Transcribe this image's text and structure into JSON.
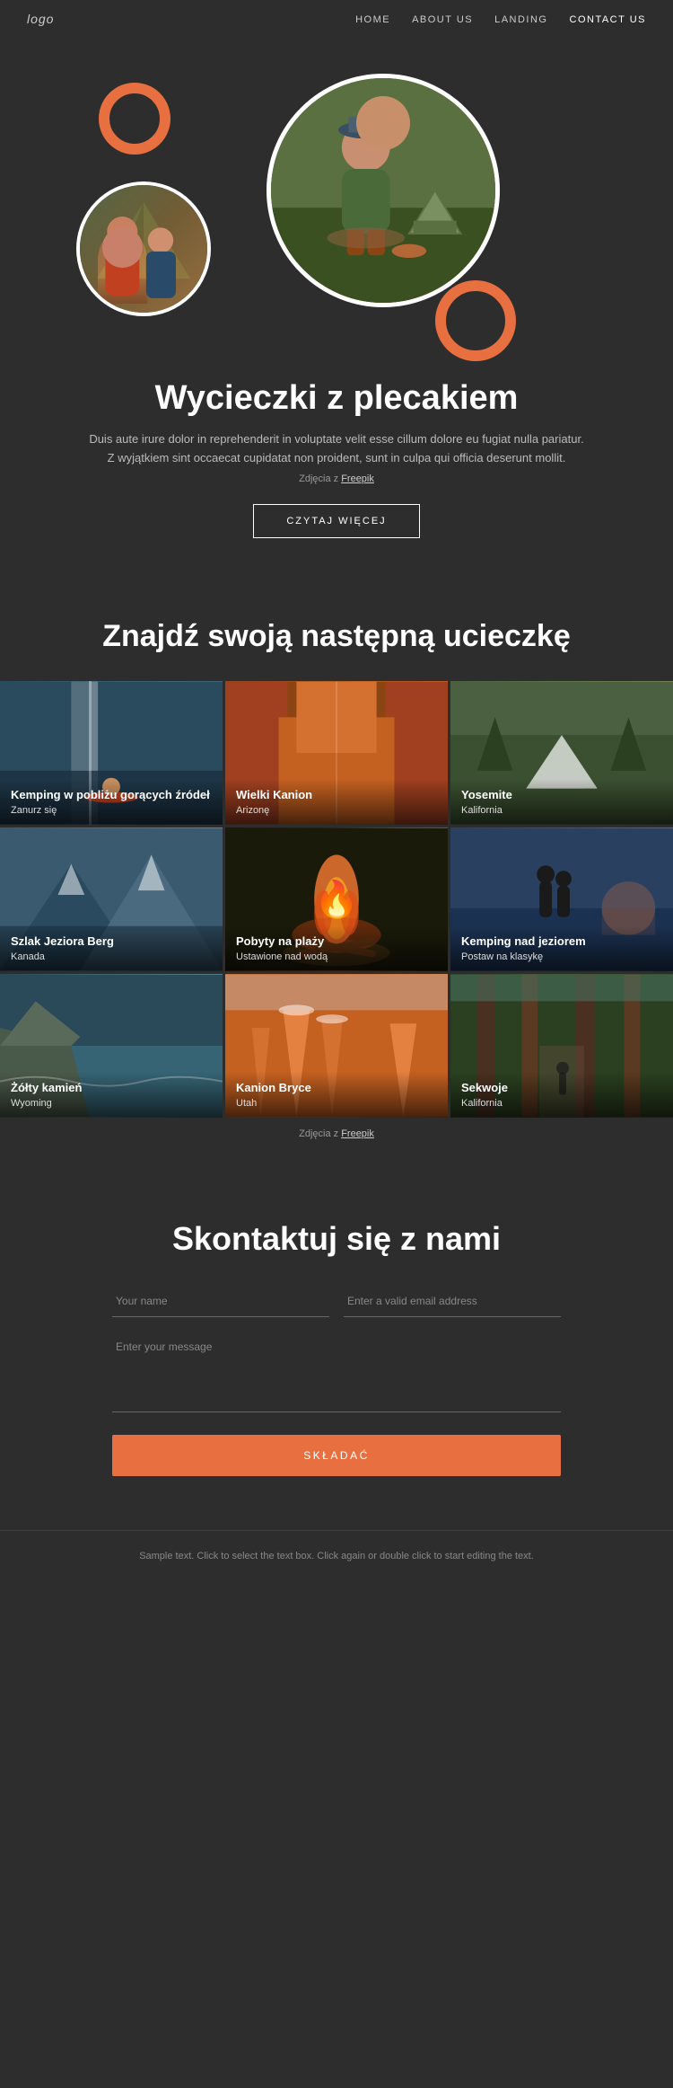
{
  "nav": {
    "logo": "logo",
    "links": [
      {
        "label": "HOME",
        "active": false,
        "id": "home"
      },
      {
        "label": "ABOUT US",
        "active": false,
        "id": "about"
      },
      {
        "label": "LANDING",
        "active": false,
        "id": "landing"
      },
      {
        "label": "CONTACT US",
        "active": false,
        "id": "contact"
      }
    ]
  },
  "hero": {
    "title": "Wycieczki z plecakiem",
    "description": "Duis aute irure dolor in reprehenderit in voluptate velit esse cillum dolore eu fugiat nulla pariatur. Z wyjątkiem sint occaecat cupidatat non proident, sunt in culpa qui officia deserunt mollit.",
    "photo_credit_prefix": "Zdjęcia z ",
    "photo_credit_link": "Freepik",
    "read_more_label": "CZYTAJ WIĘCEJ"
  },
  "gallery": {
    "title": "Znajdź swoją następną ucieczkę",
    "photo_credit_prefix": "Zdjęcia z ",
    "photo_credit_link": "Freepik",
    "items": [
      {
        "title": "Kemping w pobliżu gorących źródeł",
        "subtitle": "Zanurz się",
        "bg": "waterfall"
      },
      {
        "title": "Wielki Kanion",
        "subtitle": "Arizonę",
        "bg": "canyon-red"
      },
      {
        "title": "Yosemite",
        "subtitle": "Kalifornia",
        "bg": "yosemite"
      },
      {
        "title": "Szlak Jeziora Berg",
        "subtitle": "Kanada",
        "bg": "mountains"
      },
      {
        "title": "Pobyty na plaży",
        "subtitle": "Ustawione nad wodą",
        "bg": "campfire"
      },
      {
        "title": "Kemping nad jeziorem",
        "subtitle": "Postaw na klasykę",
        "bg": "lake"
      },
      {
        "title": "Żółty kamień",
        "subtitle": "Wyoming",
        "bg": "coastal"
      },
      {
        "title": "Kanion Bryce",
        "subtitle": "Utah",
        "bg": "bryce"
      },
      {
        "title": "Sekwoje",
        "subtitle": "Kalifornia",
        "bg": "sequoia"
      }
    ]
  },
  "contact": {
    "title": "Skontaktuj się z nami",
    "name_placeholder": "Your name",
    "email_placeholder": "Enter a valid email address",
    "message_placeholder": "Enter your message",
    "submit_label": "SKŁADAĆ"
  },
  "footer": {
    "text": "Sample text. Click to select the text box. Click again or double click to start editing the text."
  }
}
